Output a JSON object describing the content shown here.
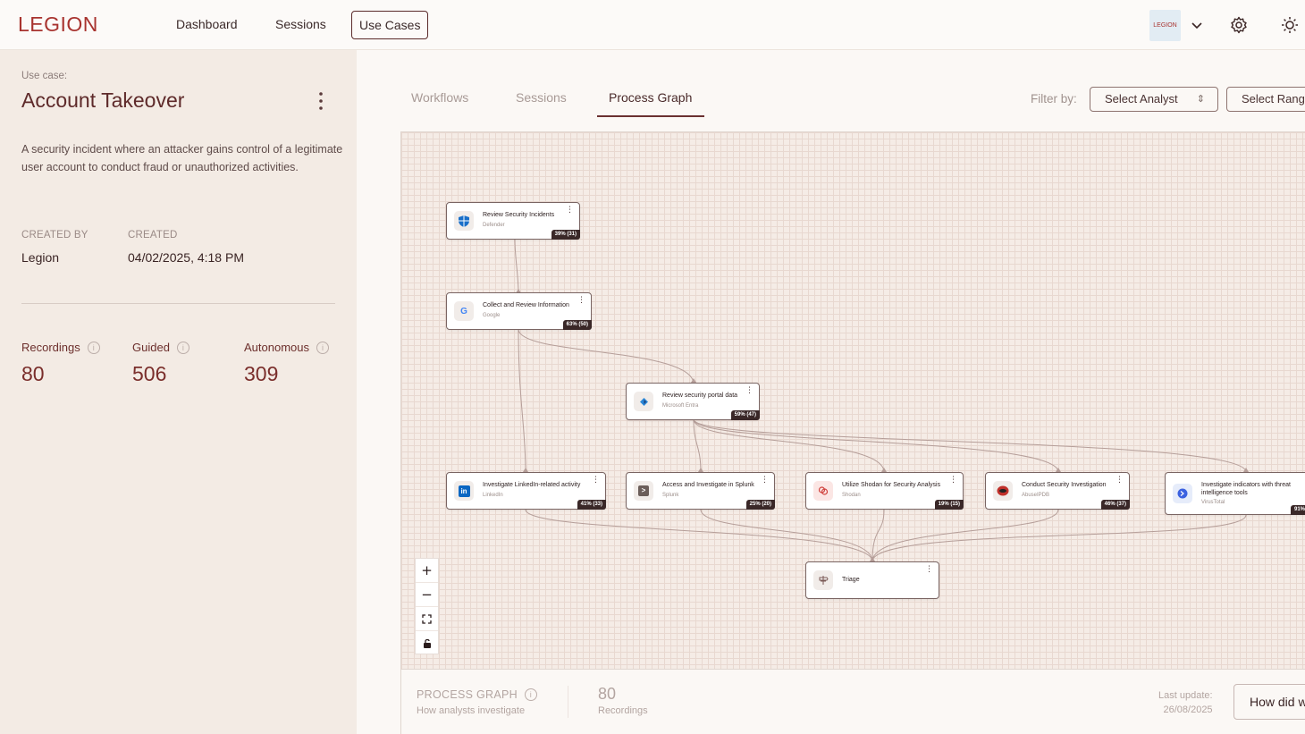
{
  "brand": {
    "logo_text": "LEGION",
    "org_logo_text": "LEGION",
    "accent": "#a8332f"
  },
  "nav": {
    "dashboard": "Dashboard",
    "sessions": "Sessions",
    "use_cases": "Use Cases",
    "icons": [
      "chevron-down-icon",
      "gear-icon",
      "sun-icon"
    ]
  },
  "use_case": {
    "label": "Use case:",
    "title": "Account Takeover",
    "description": "A security incident where an attacker gains control of a legitimate user account to conduct fraud or unauthorized activities.",
    "created_by_label": "CREATED BY",
    "created_by": "Legion",
    "created_label": "CREATED",
    "created": "04/02/2025, 4:18 PM"
  },
  "stats": [
    {
      "label": "Recordings",
      "value": "80"
    },
    {
      "label": "Guided",
      "value": "506"
    },
    {
      "label": "Autonomous",
      "value": "309"
    }
  ],
  "tabs": {
    "workflows": "Workflows",
    "sessions": "Sessions",
    "process_graph": "Process Graph",
    "active": "Process Graph"
  },
  "filter": {
    "label": "Filter by:",
    "analyst": "Select Analyst",
    "range": "Select Range"
  },
  "graph": {
    "nodes": [
      {
        "title": "Review Security Incidents",
        "sub": "Defender",
        "badge": "39% (31)",
        "icon": "defender-shield-icon"
      },
      {
        "title": "Collect and Review Information",
        "sub": "Google",
        "badge": "63% (50)",
        "icon": "google-icon"
      },
      {
        "title": "Review security portal data",
        "sub": "Microsoft Entra",
        "badge": "59% (47)",
        "icon": "entra-icon"
      },
      {
        "title": "Investigate LinkedIn-related activity",
        "sub": "LinkedIn",
        "badge": "41% (33)",
        "icon": "linkedin-icon"
      },
      {
        "title": "Access and Investigate in Splunk",
        "sub": "Splunk",
        "badge": "25% (20)",
        "icon": "splunk-icon"
      },
      {
        "title": "Utilize Shodan for Security Analysis",
        "sub": "Shodan",
        "badge": "19% (15)",
        "icon": "shodan-icon"
      },
      {
        "title": "Conduct Security Investigation",
        "sub": "AbuseIPDB",
        "badge": "46% (37)",
        "icon": "abuseipdb-icon"
      },
      {
        "title": "Investigate indicators with threat intelligence tools",
        "sub": "VirusTotal",
        "badge": "91%",
        "icon": "virustotal-icon"
      },
      {
        "title": "Triage",
        "sub": "",
        "badge": "",
        "icon": "triage-icon"
      }
    ],
    "zoom_controls": [
      "zoom-in-icon",
      "zoom-out-icon",
      "fit-view-icon",
      "lock-icon"
    ]
  },
  "footer": {
    "title": "PROCESS GRAPH",
    "subtitle": "How analysts investigate",
    "recordings_value": "80",
    "recordings_label": "Recordings",
    "last_update_label": "Last update:",
    "last_update": "26/08/2025",
    "button": "How did w"
  }
}
